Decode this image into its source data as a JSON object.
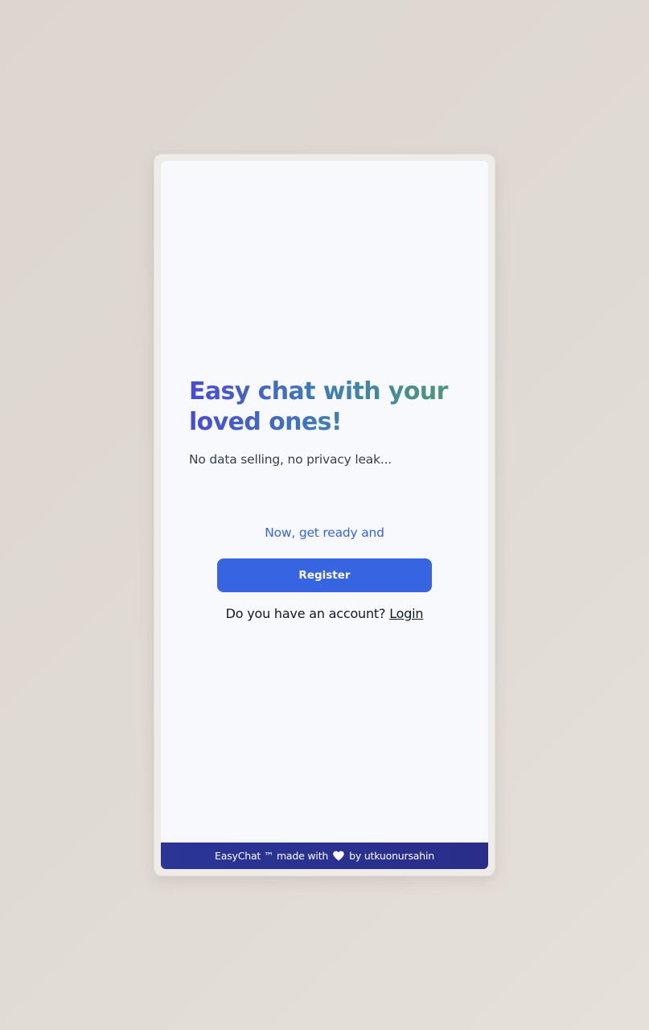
{
  "hero": {
    "headline": "Easy chat with your loved ones!",
    "subtitle": "No data selling, no privacy leak..."
  },
  "cta": {
    "prompt": "Now, get ready and",
    "register_label": "Register",
    "account_question": "Do you have an account?",
    "login_label": "Login"
  },
  "footer": {
    "text_before": "EasyChat ™ made with",
    "icon": "heart-icon",
    "text_after": "by utkuonursahin"
  },
  "colors": {
    "brand_blue": "#3764e1",
    "footer_navy": "#2a3596",
    "headline_gradient_start": "#4a4bd1",
    "headline_gradient_end": "#4e9a72"
  }
}
